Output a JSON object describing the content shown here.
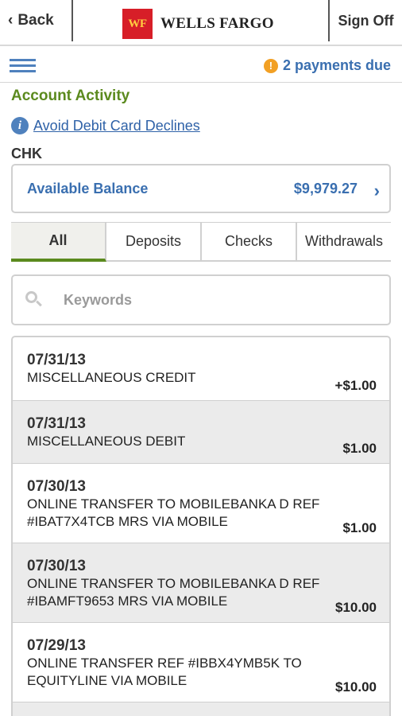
{
  "header": {
    "back_label": "Back",
    "logo_mark": "WF",
    "logo_text": "WELLS FARGO",
    "signoff_label": "Sign Off"
  },
  "subheader": {
    "payments_due": "2 payments due"
  },
  "page": {
    "title": "Account Activity",
    "info_link": "Avoid Debit Card Declines",
    "account_label": "CHK"
  },
  "balance": {
    "label": "Available Balance",
    "amount": "$9,979.27"
  },
  "tabs": [
    {
      "label": "All",
      "active": true
    },
    {
      "label": "Deposits",
      "active": false
    },
    {
      "label": "Checks",
      "active": false
    },
    {
      "label": "Withdrawals",
      "active": false
    }
  ],
  "search": {
    "placeholder": "Keywords"
  },
  "transactions": [
    {
      "date": "07/31/13",
      "description": "MISCELLANEOUS CREDIT",
      "amount": "+$1.00"
    },
    {
      "date": "07/31/13",
      "description": "MISCELLANEOUS DEBIT",
      "amount": "$1.00"
    },
    {
      "date": "07/30/13",
      "description": "ONLINE TRANSFER TO MOBILEBANKA D REF #IBAT7X4TCB MRS VIA MOBILE",
      "amount": "$1.00"
    },
    {
      "date": "07/30/13",
      "description": "ONLINE TRANSFER TO MOBILEBANKA D REF #IBAMFT9653 MRS VIA MOBILE",
      "amount": "$10.00"
    },
    {
      "date": "07/29/13",
      "description": "ONLINE TRANSFER REF #IBBX4YMB5K TO EQUITYLINE VIA MOBILE",
      "amount": "$10.00"
    }
  ],
  "colors": {
    "brand_red": "#d71e28",
    "brand_gold": "#ffcd41",
    "accent_green": "#5b8a1e",
    "link_blue": "#3a6fb0",
    "alert_orange": "#f2a024"
  }
}
